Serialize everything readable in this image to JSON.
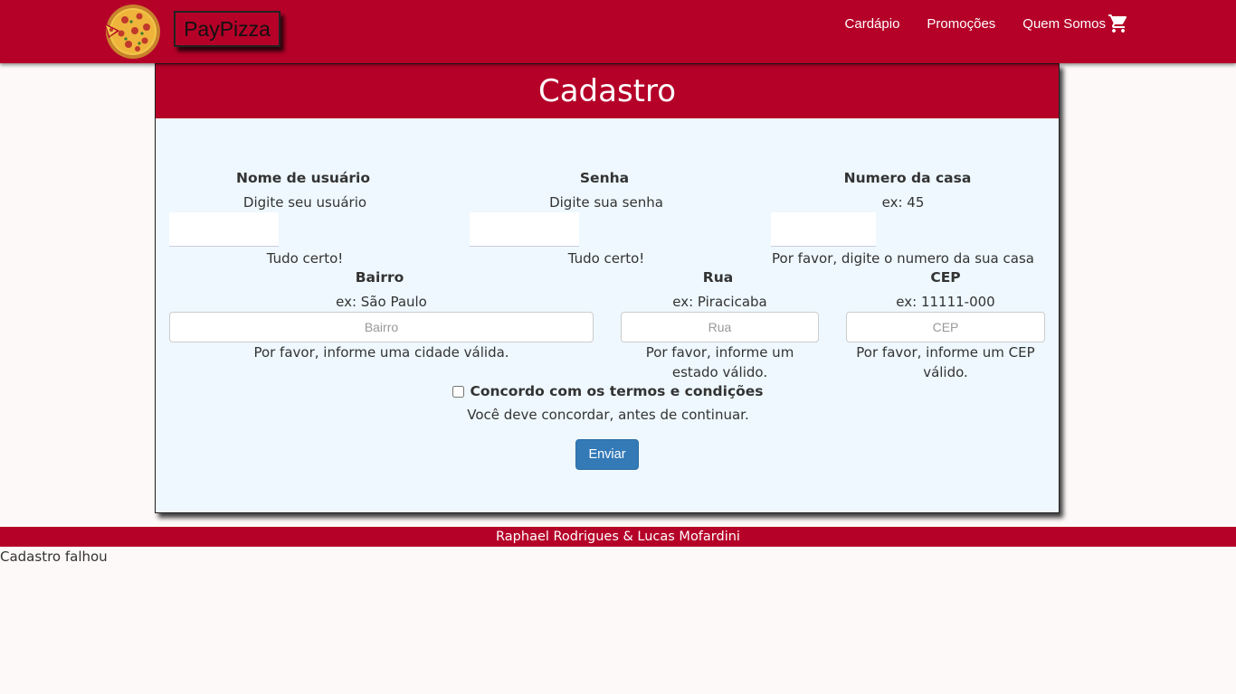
{
  "header": {
    "brand": "PayPizza",
    "logo_icon": "pizza-icon",
    "nav": [
      {
        "label": "Cardápio"
      },
      {
        "label": "Promoções"
      },
      {
        "label": "Quem Somos"
      }
    ],
    "cart_icon": "cart-icon",
    "color": "#b50028"
  },
  "form": {
    "title": "Cadastro",
    "username": {
      "label": "Nome de usuário",
      "hint": "Digite seu usuário",
      "value": "",
      "feedback": "Tudo certo!"
    },
    "password": {
      "label": "Senha",
      "hint": "Digite sua senha",
      "value": "",
      "feedback": "Tudo certo!"
    },
    "house_number": {
      "label": "Numero da casa",
      "hint": "ex: 45",
      "value": "",
      "feedback": "Por favor, digite o numero da sua casa"
    },
    "neighborhood": {
      "label": "Bairro",
      "hint": "ex: São Paulo",
      "placeholder": "Bairro",
      "value": "",
      "feedback": "Por favor, informe uma cidade válida."
    },
    "street": {
      "label": "Rua",
      "hint": "ex: Piracicaba",
      "placeholder": "Rua",
      "value": "",
      "feedback": "Por favor, informe um estado válido."
    },
    "zip": {
      "label": "CEP",
      "hint": "ex: 11111-000",
      "placeholder": "CEP",
      "value": "",
      "feedback": "Por favor, informe um CEP válido."
    },
    "terms": {
      "label": "Concordo com os termos e condições",
      "checked": false,
      "feedback": "Você deve concordar, antes de continuar."
    },
    "submit_label": "Enviar",
    "button_color": "#337ab7"
  },
  "footer": {
    "text": "Raphael Rodrigues & Lucas Mofardini"
  },
  "status": {
    "text": "Cadastro falhou"
  }
}
